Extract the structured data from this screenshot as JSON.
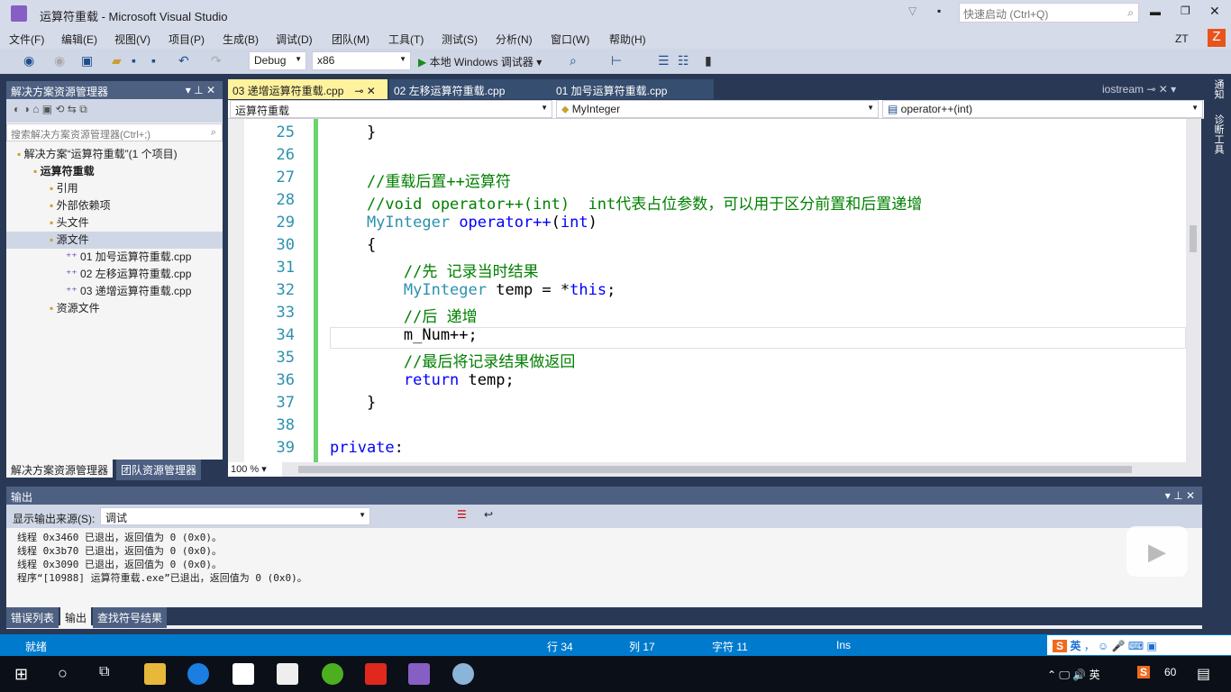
{
  "window": {
    "title": "运算符重载 - Microsoft Visual Studio",
    "quick_launch_placeholder": "快速启动 (Ctrl+Q)",
    "user": "ZT",
    "avatar_letter": "Z"
  },
  "menu": [
    "文件(F)",
    "编辑(E)",
    "视图(V)",
    "项目(P)",
    "生成(B)",
    "调试(D)",
    "团队(M)",
    "工具(T)",
    "测试(S)",
    "分析(N)",
    "窗口(W)",
    "帮助(H)"
  ],
  "toolbar": {
    "config": "Debug",
    "platform": "x86",
    "run_label": "本地 Windows 调试器"
  },
  "solution_explorer": {
    "title": "解决方案资源管理器",
    "search_placeholder": "搜索解决方案资源管理器(Ctrl+;)",
    "items": [
      {
        "label": "解决方案“运算符重载”(1 个项目)",
        "indent": 0
      },
      {
        "label": "运算符重载",
        "indent": 1,
        "bold": true
      },
      {
        "label": "引用",
        "indent": 2
      },
      {
        "label": "外部依赖项",
        "indent": 2
      },
      {
        "label": "头文件",
        "indent": 2
      },
      {
        "label": "源文件",
        "indent": 2,
        "selected": true
      },
      {
        "label": "01 加号运算符重载.cpp",
        "indent": 3
      },
      {
        "label": "02 左移运算符重载.cpp",
        "indent": 3
      },
      {
        "label": "03 递增运算符重载.cpp",
        "indent": 3
      },
      {
        "label": "资源文件",
        "indent": 2
      }
    ],
    "bottom_tabs": [
      "解决方案资源管理器",
      "团队资源管理器"
    ]
  },
  "editor": {
    "tabs": [
      "03 递增运算符重载.cpp",
      "02 左移运算符重载.cpp",
      "01 加号运算符重载.cpp"
    ],
    "right_tab": "iostream",
    "nav": [
      "运算符重载",
      "MyInteger",
      "operator++(int)"
    ],
    "zoom": "100 %",
    "lines": [
      {
        "n": "25",
        "segs": [
          [
            "tx",
            "    }"
          ]
        ]
      },
      {
        "n": "26",
        "segs": []
      },
      {
        "n": "27",
        "segs": [
          [
            "cm",
            "    //重载后置++运算符"
          ]
        ]
      },
      {
        "n": "28",
        "segs": [
          [
            "cm",
            "    //void operator++(int)  int代表占位参数，可以用于区分前置和后置递增"
          ]
        ]
      },
      {
        "n": "29",
        "segs": [
          [
            "ty",
            "    MyInteger"
          ],
          [
            "tx",
            " "
          ],
          [
            "kw",
            "operator++"
          ],
          [
            "tx",
            "("
          ],
          [
            "kw",
            "int"
          ],
          [
            "tx",
            ")"
          ]
        ]
      },
      {
        "n": "30",
        "segs": [
          [
            "tx",
            "    {"
          ]
        ]
      },
      {
        "n": "31",
        "segs": [
          [
            "cm",
            "        //先 记录当时结果"
          ]
        ]
      },
      {
        "n": "32",
        "segs": [
          [
            "ty",
            "        MyInteger"
          ],
          [
            "tx",
            " temp = *"
          ],
          [
            "kw",
            "this"
          ],
          [
            "tx",
            ";"
          ]
        ]
      },
      {
        "n": "33",
        "segs": [
          [
            "cm",
            "        //后 递增"
          ]
        ]
      },
      {
        "n": "34",
        "segs": [
          [
            "tx",
            "        m_Num++;"
          ]
        ]
      },
      {
        "n": "35",
        "segs": [
          [
            "cm",
            "        //最后将记录结果做返回"
          ]
        ]
      },
      {
        "n": "36",
        "segs": [
          [
            "kw",
            "        return"
          ],
          [
            "tx",
            " temp;"
          ]
        ]
      },
      {
        "n": "37",
        "segs": [
          [
            "tx",
            "    }"
          ]
        ]
      },
      {
        "n": "38",
        "segs": []
      },
      {
        "n": "39",
        "segs": [
          [
            "kw",
            "private"
          ],
          [
            "tx",
            ":"
          ]
        ]
      }
    ]
  },
  "right_strip": [
    "通知",
    "诊断工具"
  ],
  "output": {
    "title": "输出",
    "source_label": "显示输出来源(S):",
    "source": "调试",
    "lines": [
      "线程 0x3460 已退出，返回值为 0 (0x0)。",
      "线程 0x3b70 已退出，返回值为 0 (0x0)。",
      "线程 0x3090 已退出，返回值为 0 (0x0)。",
      "程序“[10988] 运算符重载.exe”已退出，返回值为 0 (0x0)。"
    ],
    "tabs": [
      "错误列表",
      "输出",
      "查找符号结果"
    ]
  },
  "status": {
    "ready": "就绪",
    "line": "行 34",
    "col": "列 17",
    "char": "字符 11",
    "mode": "Ins",
    "ime": "英"
  },
  "taskbar": {
    "ime": "英",
    "badge": "60"
  },
  "colors": {
    "accent": "#007acc",
    "tab_active": "#fff29d",
    "frame": "#293955"
  }
}
